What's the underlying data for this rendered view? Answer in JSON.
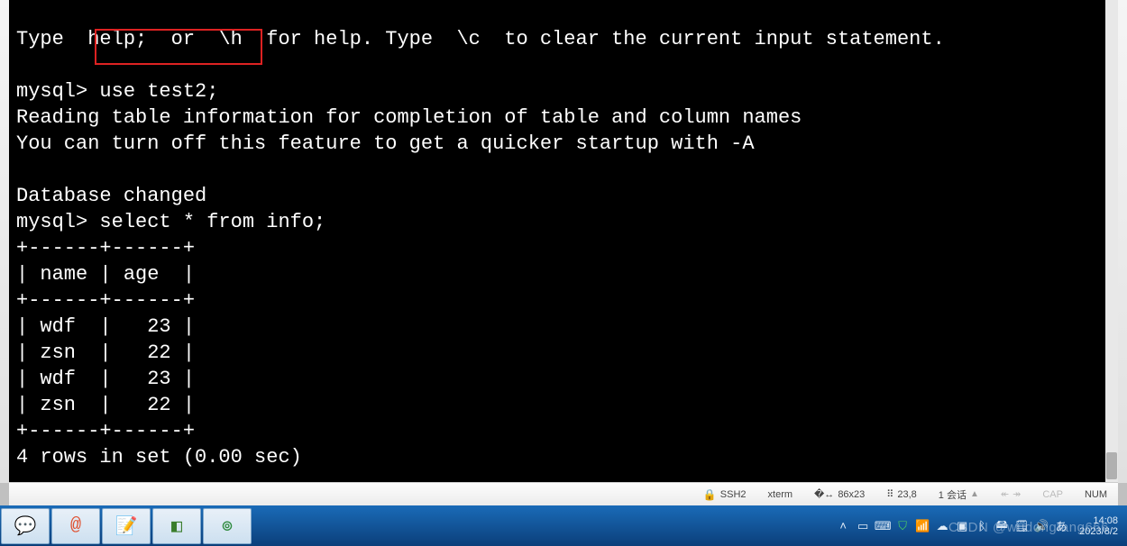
{
  "terminal": {
    "top_fragment": "Type  help;  or  \\h  for help. Type  \\c  to clear the current input statement.",
    "prompt": "mysql>",
    "cmd_use": " use test2;",
    "reading1": "Reading table information for completion of table and column names",
    "reading2": "You can turn off this feature to get a quicker startup with -A",
    "db_changed": "Database changed",
    "cmd_select": "mysql> select * from info;",
    "border": "+------+------+",
    "header_row": "| name | age  |",
    "rows": [
      "| wdf  |   23 |",
      "| zsn  |   22 |",
      "| wdf  |   23 |",
      "| zsn  |   22 |"
    ],
    "footer": "4 rows in set (0.00 sec)",
    "chart_data": {
      "type": "table",
      "columns": [
        "name",
        "age"
      ],
      "rows": [
        [
          "wdf",
          23
        ],
        [
          "zsn",
          22
        ],
        [
          "wdf",
          23
        ],
        [
          "zsn",
          22
        ]
      ],
      "row_count": 4,
      "elapsed_sec": 0.0
    }
  },
  "status": {
    "ssh": "SSH2",
    "term": "xterm",
    "size": "86x23",
    "pos": "23,8",
    "sessions": "1 会话",
    "cap": "CAP",
    "num": "NUM"
  },
  "tray": {
    "time": "14:08",
    "date": "2023/8/2"
  },
  "watermark": "CSDN @wudongfang666"
}
